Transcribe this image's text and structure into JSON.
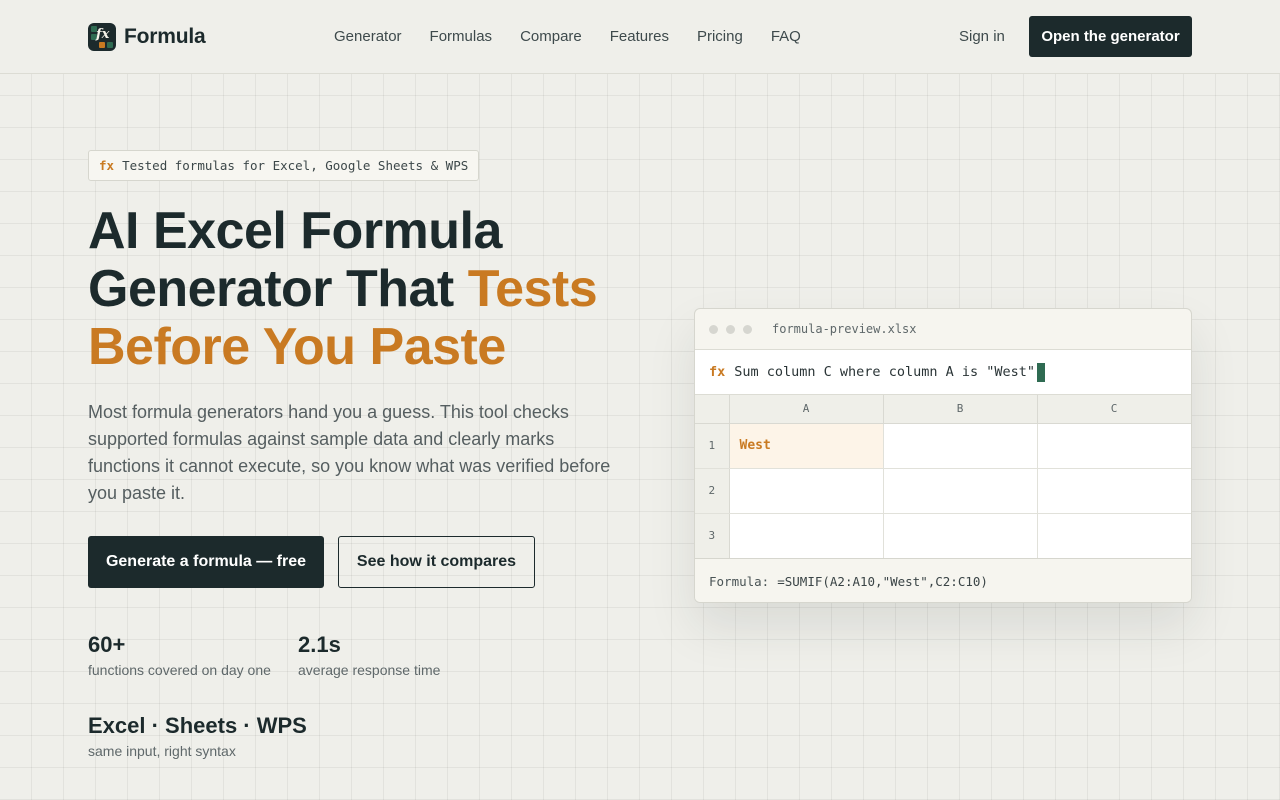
{
  "header": {
    "brand": "Formula",
    "logo_glyph": "fx",
    "nav": [
      "Generator",
      "Formulas",
      "Compare",
      "Features",
      "Pricing",
      "FAQ"
    ],
    "sign_in": "Sign in",
    "cta": "Open the generator"
  },
  "hero": {
    "badge_prefix": "fx",
    "badge_text": "Tested formulas for Excel, Google Sheets & WPS",
    "headline_line1": "AI Excel Formula",
    "headline_line2a": "Generator That ",
    "headline_accent_a": "Tests",
    "headline_accent_b": "Before You Paste",
    "description": "Most formula generators hand you a guess. This tool checks supported formulas against sample data and clearly marks functions it cannot execute, so you know what was verified before you paste it.",
    "primary_cta": "Generate a formula — free",
    "secondary_cta": "See how it compares"
  },
  "stats": [
    {
      "value": "60+",
      "label": "functions covered on day one"
    },
    {
      "value": "2.1s",
      "label": "average response time"
    },
    {
      "value": "Excel · Sheets · WPS",
      "label": "same input, right syntax"
    }
  ],
  "preview": {
    "filename": "formula-preview.xlsx",
    "fx_prefix": "fx",
    "query": "Sum column C where column A is \"West\"",
    "columns": [
      "A",
      "B",
      "C"
    ],
    "rows": [
      {
        "num": "1",
        "cells": [
          "West",
          "",
          ""
        ]
      },
      {
        "num": "2",
        "cells": [
          "",
          "",
          ""
        ]
      },
      {
        "num": "3",
        "cells": [
          "",
          "",
          ""
        ]
      }
    ],
    "formula_label": "Formula:",
    "formula_value": "=SUMIF(A2:A10,\"West\",C2:C10)"
  },
  "colors": {
    "ink": "#1c2a2c",
    "accent": "#c97a22",
    "background": "#efefea",
    "cursor": "#2f6b52"
  },
  "icons": {
    "logo": "spreadsheet-fx-logo-icon",
    "window_controls": "window-dot-icon"
  }
}
